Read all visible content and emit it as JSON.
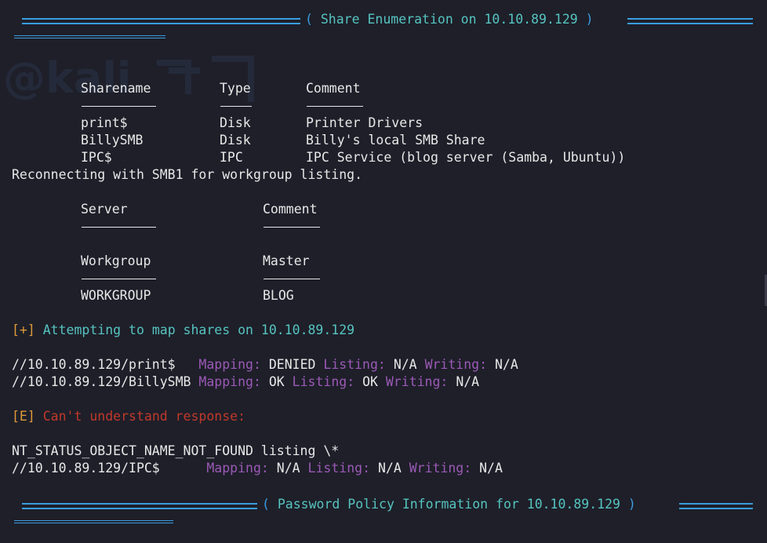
{
  "header1": {
    "title": "Share Enumeration on 10.10.89.129"
  },
  "shares_table": {
    "columns": [
      "Sharename",
      "Type",
      "Comment"
    ],
    "rows": [
      [
        "print$",
        "Disk",
        "Printer Drivers"
      ],
      [
        "BillySMB",
        "Disk",
        "Billy's local SMB Share"
      ],
      [
        "IPC$",
        "IPC",
        "IPC Service (blog server (Samba, Ubuntu))"
      ]
    ]
  },
  "reconnect_line": "Reconnecting with SMB1 for workgroup listing.",
  "server_table": {
    "columns": [
      "Server",
      "Comment"
    ]
  },
  "workgroup_table": {
    "columns": [
      "Workgroup",
      "Master"
    ],
    "rows": [
      [
        "WORKGROUP",
        "BLOG"
      ]
    ]
  },
  "attempt_line": {
    "prefix": "[+]",
    "text": "Attempting to map shares on 10.10.89.129"
  },
  "mappings": [
    {
      "path": "//10.10.89.129/print$   ",
      "mapping_label": "Mapping:",
      "mapping": "DENIED",
      "listing_label": "Listing:",
      "listing": "N/A",
      "writing_label": "Writing:",
      "writing": "N/A"
    },
    {
      "path": "//10.10.89.129/BillySMB ",
      "mapping_label": "Mapping:",
      "mapping": "OK",
      "listing_label": "Listing:",
      "listing": "OK",
      "writing_label": "Writing:",
      "writing": "N/A"
    }
  ],
  "error_line": {
    "prefix": "[E]",
    "text": "Can't understand response:"
  },
  "nt_status_line": "NT_STATUS_OBJECT_NAME_NOT_FOUND listing \\*",
  "ipc_mapping": {
    "path": "//10.10.89.129/IPC$      ",
    "mapping_label": "Mapping:",
    "mapping": "N/A",
    "listing_label": "Listing:",
    "listing": "N/A",
    "writing_label": "Writing:",
    "writing": "N/A"
  },
  "header2": {
    "title": "Password Policy Information for 10.10.89.129"
  },
  "colors": {
    "background": "#1e1f29",
    "rule_blue": "#3a9de0",
    "teal": "#56c4c0",
    "orange": "#e09a3a",
    "red": "#c0392b",
    "purple": "#9b59b6",
    "text": "#e8e8e8"
  }
}
